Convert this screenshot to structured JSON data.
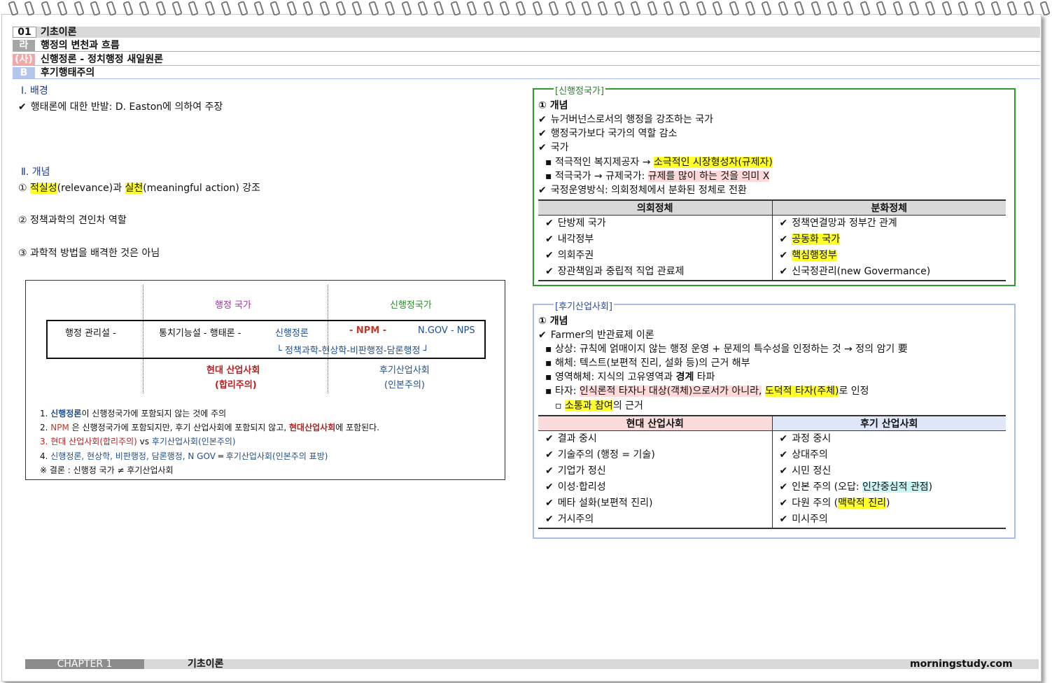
{
  "header": {
    "num": "01",
    "title": "기초이론",
    "la_tag": "라",
    "la_title": "행정의 변천과 흐름",
    "sa_tag": "(사)",
    "sa_title": "신행정론 - 정치행정 새일원론",
    "b_tag": "B",
    "b_title": "후기행태주의"
  },
  "left": {
    "s1": "Ⅰ. 배경",
    "s1_item": "행태론에 대한 반발: D. Easton에 의하여 주장",
    "s2": "Ⅱ. 개념",
    "c1_num": "①",
    "c1_a": "적실성",
    "c1_b": "(relevance)과 ",
    "c1_c": "실천",
    "c1_d": "(meaningful action) 강조",
    "c2": "② 정책과학의 견인차 역할",
    "c3": "③ 과학적 방법을 배격한 것은 아님"
  },
  "diagram": {
    "col_a": "행정 국가",
    "col_b": "신행정국가",
    "r1": "행정 관리설 -",
    "r2": "통치기능설 - 행태론 -",
    "r3": "신행정론",
    "r4": "- NPM -",
    "r5": "N.GOV - NPS",
    "r6": "└ 정책과학-현상학-비판행정-담론행정 ┘",
    "m1": "현대 산업사회",
    "m2": "(합리주의)",
    "p1": "후기산업사회",
    "p2": "(인본주의)",
    "n1a": "1. ",
    "n1b": "신행정론",
    "n1c": "이 신행정국가에 포함되지 않는 것에 주의",
    "n2a": "2. ",
    "n2b": "NPM",
    "n2c": " 은 신행정국가에 포함되지만, 후기 산업사회에 포함되지 않고, ",
    "n2d": "현대산업사회",
    "n2e": "에 포함된다.",
    "n3a": "3. ",
    "n3b": "현대 산업사회(합리주의)",
    "n3c": " vs ",
    "n3d": "후기산업사회(인본주의)",
    "n4a": "4. ",
    "n4b": "신행정론, 현상학, 비판행정, 담론행정, N GOV",
    "n4c": " ═ ",
    "n4d": "후기산업사회(인본주의 표방)",
    "n5": "※ 결론 : 신행정 국가 ≠ 후기산업사회"
  },
  "box1": {
    "label": "[신행정국가]",
    "concept": "① 개념",
    "i1": "뉴거버넌스로서의 행정을 강조하는 국가",
    "i2": "행정국가보다 국가의 역할 감소",
    "i3": "국가",
    "i4a": "▪ 적극적인 복지제공자 → ",
    "i4b": "소극적인 시장형성자(규제자)",
    "i5a": "▪ 적극국가 → 규제국가: ",
    "i5b": "규제를 많이 하는 것을 의미 X",
    "i6": "국정운영방식: 의회정체에서 분화된 정체로 전환",
    "th_l": "의회정체",
    "th_r": "분화정체",
    "rows": [
      {
        "l": "단방제 국가",
        "r": "정책연결망과 정부간 관계",
        "rh": ""
      },
      {
        "l": "내각정부",
        "r": "공동화 국가",
        "rh": "y"
      },
      {
        "l": "의회주권",
        "r": "핵심행정부",
        "rh": "y"
      },
      {
        "l": "장관책임과 중립적 직업 관료제",
        "r": "신국정관리(new Govermance)",
        "rh": ""
      }
    ]
  },
  "box2": {
    "label": "[후기산업사회]",
    "concept": "① 개념",
    "i1": "Farmer의 반관료제 이론",
    "i2": "▪ 상상: 규칙에 얽매이지 않는 행정 운영 + 문제의 특수성을 인정하는 것 → 정의 암기 要",
    "i3": "▪ 해체: 텍스트(보편적 진리, 설화 등)의 근거 해부",
    "i4a": "▪ 영역해체: 지식의 고유영역과 ",
    "i4b": "경계",
    "i4c": " 타파",
    "i5a": "▪ 타자: ",
    "i5b": "인식론적 타자나 대상(객체)으로서가 아니라,",
    "i5c": " ",
    "i5d": "도덕적 타자(주체)",
    "i5e": "로 인정",
    "i6a": "▫ ",
    "i6b": "소통과 참여",
    "i6c": "의 근거",
    "th_l": "현대 산업사회",
    "th_r": "후기 산업사회",
    "rows": [
      {
        "l": "결과 중시",
        "r": "과정 중시"
      },
      {
        "l": "기술주의 (행정 = 기술)",
        "r": "상대주의"
      },
      {
        "l": "기업가 정신",
        "r": "시민 정신"
      },
      {
        "l": "이성·합리성",
        "r": "인본 주의 (오답: ",
        "r2": "인간중심적 관점",
        "r3": ")"
      },
      {
        "l": "메타 설화(보편적 진리)",
        "r": "다원 주의 (",
        "r2": "맥락적 진리",
        "r3": ")"
      },
      {
        "l": "거시주의",
        "r": "미시주의"
      }
    ]
  },
  "footer": {
    "chapter": "CHAPTER 1",
    "title": "기초이론",
    "site": "morningstudy.com"
  }
}
